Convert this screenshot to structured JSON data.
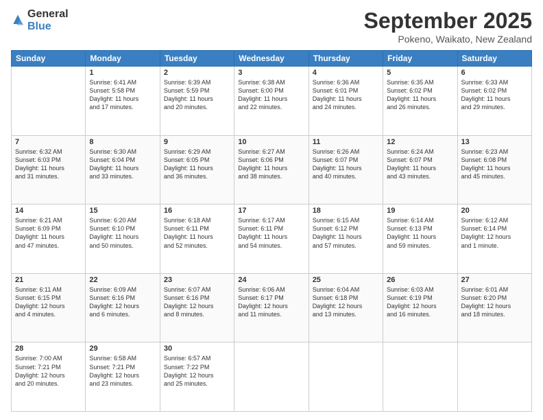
{
  "header": {
    "logo": {
      "text_general": "General",
      "text_blue": "Blue"
    },
    "title": "September 2025",
    "location": "Pokeno, Waikato, New Zealand"
  },
  "calendar": {
    "days_of_week": [
      "Sunday",
      "Monday",
      "Tuesday",
      "Wednesday",
      "Thursday",
      "Friday",
      "Saturday"
    ],
    "weeks": [
      [
        {
          "day": "",
          "content": ""
        },
        {
          "day": "1",
          "content": "Sunrise: 6:41 AM\nSunset: 5:58 PM\nDaylight: 11 hours\nand 17 minutes."
        },
        {
          "day": "2",
          "content": "Sunrise: 6:39 AM\nSunset: 5:59 PM\nDaylight: 11 hours\nand 20 minutes."
        },
        {
          "day": "3",
          "content": "Sunrise: 6:38 AM\nSunset: 6:00 PM\nDaylight: 11 hours\nand 22 minutes."
        },
        {
          "day": "4",
          "content": "Sunrise: 6:36 AM\nSunset: 6:01 PM\nDaylight: 11 hours\nand 24 minutes."
        },
        {
          "day": "5",
          "content": "Sunrise: 6:35 AM\nSunset: 6:02 PM\nDaylight: 11 hours\nand 26 minutes."
        },
        {
          "day": "6",
          "content": "Sunrise: 6:33 AM\nSunset: 6:02 PM\nDaylight: 11 hours\nand 29 minutes."
        }
      ],
      [
        {
          "day": "7",
          "content": "Sunrise: 6:32 AM\nSunset: 6:03 PM\nDaylight: 11 hours\nand 31 minutes."
        },
        {
          "day": "8",
          "content": "Sunrise: 6:30 AM\nSunset: 6:04 PM\nDaylight: 11 hours\nand 33 minutes."
        },
        {
          "day": "9",
          "content": "Sunrise: 6:29 AM\nSunset: 6:05 PM\nDaylight: 11 hours\nand 36 minutes."
        },
        {
          "day": "10",
          "content": "Sunrise: 6:27 AM\nSunset: 6:06 PM\nDaylight: 11 hours\nand 38 minutes."
        },
        {
          "day": "11",
          "content": "Sunrise: 6:26 AM\nSunset: 6:07 PM\nDaylight: 11 hours\nand 40 minutes."
        },
        {
          "day": "12",
          "content": "Sunrise: 6:24 AM\nSunset: 6:07 PM\nDaylight: 11 hours\nand 43 minutes."
        },
        {
          "day": "13",
          "content": "Sunrise: 6:23 AM\nSunset: 6:08 PM\nDaylight: 11 hours\nand 45 minutes."
        }
      ],
      [
        {
          "day": "14",
          "content": "Sunrise: 6:21 AM\nSunset: 6:09 PM\nDaylight: 11 hours\nand 47 minutes."
        },
        {
          "day": "15",
          "content": "Sunrise: 6:20 AM\nSunset: 6:10 PM\nDaylight: 11 hours\nand 50 minutes."
        },
        {
          "day": "16",
          "content": "Sunrise: 6:18 AM\nSunset: 6:11 PM\nDaylight: 11 hours\nand 52 minutes."
        },
        {
          "day": "17",
          "content": "Sunrise: 6:17 AM\nSunset: 6:11 PM\nDaylight: 11 hours\nand 54 minutes."
        },
        {
          "day": "18",
          "content": "Sunrise: 6:15 AM\nSunset: 6:12 PM\nDaylight: 11 hours\nand 57 minutes."
        },
        {
          "day": "19",
          "content": "Sunrise: 6:14 AM\nSunset: 6:13 PM\nDaylight: 11 hours\nand 59 minutes."
        },
        {
          "day": "20",
          "content": "Sunrise: 6:12 AM\nSunset: 6:14 PM\nDaylight: 12 hours\nand 1 minute."
        }
      ],
      [
        {
          "day": "21",
          "content": "Sunrise: 6:11 AM\nSunset: 6:15 PM\nDaylight: 12 hours\nand 4 minutes."
        },
        {
          "day": "22",
          "content": "Sunrise: 6:09 AM\nSunset: 6:16 PM\nDaylight: 12 hours\nand 6 minutes."
        },
        {
          "day": "23",
          "content": "Sunrise: 6:07 AM\nSunset: 6:16 PM\nDaylight: 12 hours\nand 8 minutes."
        },
        {
          "day": "24",
          "content": "Sunrise: 6:06 AM\nSunset: 6:17 PM\nDaylight: 12 hours\nand 11 minutes."
        },
        {
          "day": "25",
          "content": "Sunrise: 6:04 AM\nSunset: 6:18 PM\nDaylight: 12 hours\nand 13 minutes."
        },
        {
          "day": "26",
          "content": "Sunrise: 6:03 AM\nSunset: 6:19 PM\nDaylight: 12 hours\nand 16 minutes."
        },
        {
          "day": "27",
          "content": "Sunrise: 6:01 AM\nSunset: 6:20 PM\nDaylight: 12 hours\nand 18 minutes."
        }
      ],
      [
        {
          "day": "28",
          "content": "Sunrise: 7:00 AM\nSunset: 7:21 PM\nDaylight: 12 hours\nand 20 minutes."
        },
        {
          "day": "29",
          "content": "Sunrise: 6:58 AM\nSunset: 7:21 PM\nDaylight: 12 hours\nand 23 minutes."
        },
        {
          "day": "30",
          "content": "Sunrise: 6:57 AM\nSunset: 7:22 PM\nDaylight: 12 hours\nand 25 minutes."
        },
        {
          "day": "",
          "content": ""
        },
        {
          "day": "",
          "content": ""
        },
        {
          "day": "",
          "content": ""
        },
        {
          "day": "",
          "content": ""
        }
      ]
    ]
  }
}
